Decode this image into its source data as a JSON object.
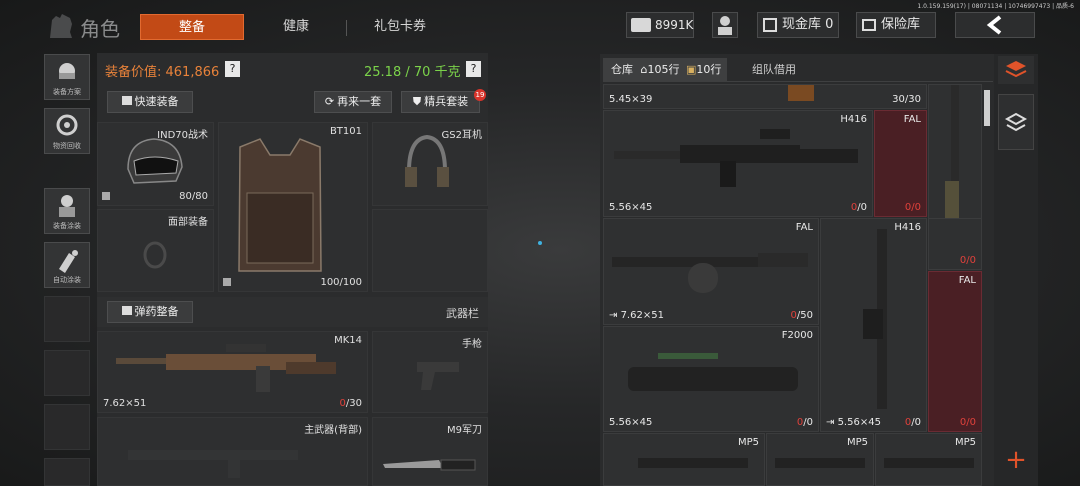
{
  "version_text": "1.0.159.159(17) | 08071134 | 10746997473 | 品质-6",
  "title": "角色",
  "tabs": [
    {
      "label": "整备",
      "active": true
    },
    {
      "label": "健康",
      "active": false
    },
    {
      "label": "礼包卡券",
      "active": false
    }
  ],
  "top_bar": {
    "currency_value": "8991K",
    "cash_vault_label": "现金库 0",
    "insurance_label": "保险库"
  },
  "side_buttons": [
    {
      "label": "装备方案"
    },
    {
      "label": "物资回收"
    },
    {
      "label": "装备涂装"
    },
    {
      "label": "自动涂装"
    }
  ],
  "equipment": {
    "value_label": "装备价值: 461,866",
    "weight_label": "25.18 / 70 千克",
    "quick_equip": "快速装备",
    "again_set": "再来一套",
    "elite_set": "精兵套装",
    "elite_badge": "19",
    "helmet": {
      "name": "IND70战术",
      "durability": "80/80"
    },
    "armor": {
      "name": "BT101",
      "durability": "100/100"
    },
    "headset": {
      "name": "GS2耳机"
    },
    "face": {
      "name": "面部装备"
    },
    "ammo_button": "弹药整备",
    "weapon_bar_label": "武器栏",
    "primary": {
      "name": "MK14",
      "caliber": "7.62×51",
      "ammo_used": "0",
      "ammo_total": "/30"
    },
    "pistol": {
      "name": "手枪"
    },
    "back_weapon": {
      "name": "主武器(背部)"
    },
    "knife": {
      "name": "M9军刀"
    }
  },
  "storage": {
    "tab_warehouse": "仓库",
    "warehouse_rows": "105行",
    "warehouse_rows2": "10行",
    "tab_team_borrow": "组队借用",
    "top_caliber": "5.45×39",
    "top_ammo": "30/30",
    "items": [
      {
        "name": "H416",
        "caliber": "5.56×45",
        "ammo_used": "0",
        "ammo_total": "/0"
      },
      {
        "name": "FAL",
        "ammo_used": "0",
        "ammo_total": "/0"
      },
      {
        "name": "FAL",
        "caliber": "7.62×51",
        "ammo_used": "0",
        "ammo_total": "/50"
      },
      {
        "name": "H416",
        "caliber": "5.56×45",
        "ammo_used": "0",
        "ammo_total": "/0"
      },
      {
        "name": "FAL",
        "ammo_used": "0",
        "ammo_total": "/0"
      },
      {
        "name": "F2000",
        "caliber": "5.56×45",
        "ammo_used": "0",
        "ammo_total": "/0"
      },
      {
        "name": "MP5"
      },
      {
        "name": "MP5"
      },
      {
        "name": "MP5"
      }
    ]
  },
  "colors": {
    "accent": "#c24a16",
    "weight_green": "#7bd34a",
    "value_orange": "#e8823a",
    "warning_red": "#e0413b"
  }
}
